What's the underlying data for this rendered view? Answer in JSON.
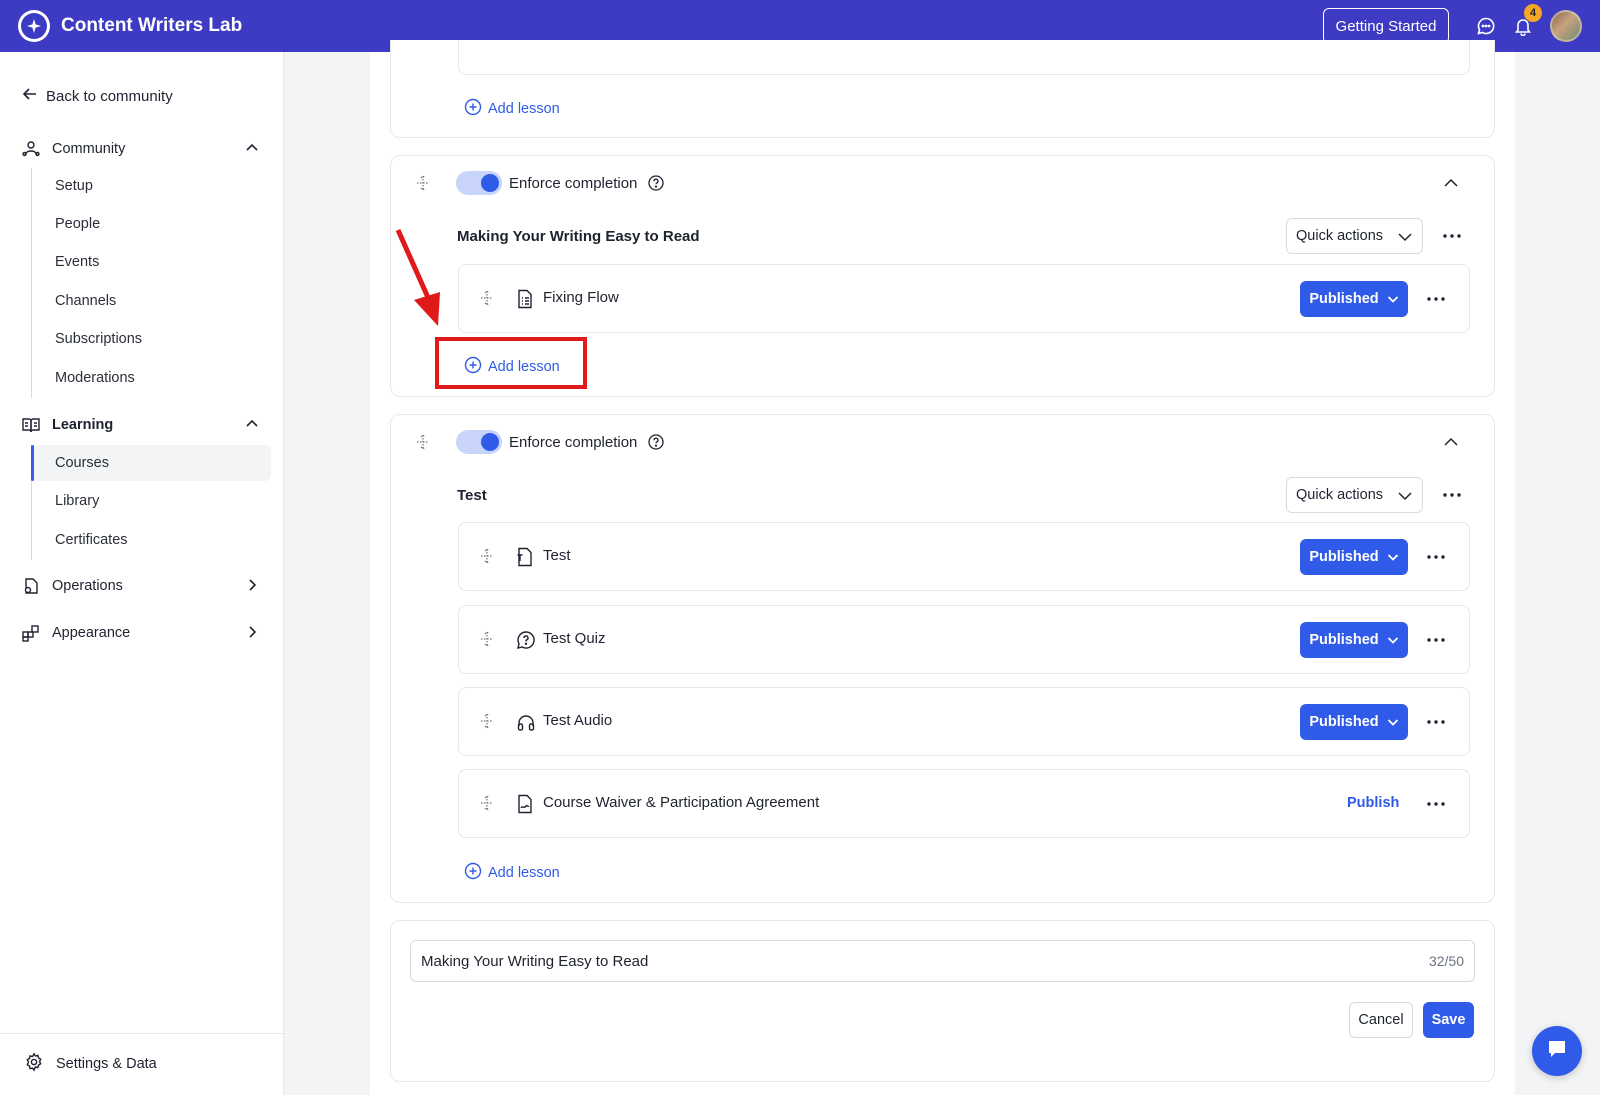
{
  "header": {
    "app_title": "Content Writers Lab",
    "getting_started_label": "Getting Started",
    "notification_count": "4"
  },
  "sidebar": {
    "back_label": "Back to community",
    "community": {
      "label": "Community",
      "items": [
        "Setup",
        "People",
        "Events",
        "Channels",
        "Subscriptions",
        "Moderations"
      ]
    },
    "learning": {
      "label": "Learning",
      "items": [
        "Courses",
        "Library",
        "Certificates"
      ],
      "active": "Courses"
    },
    "operations_label": "Operations",
    "appearance_label": "Appearance",
    "settings_label": "Settings & Data"
  },
  "main": {
    "add_lesson_label": "Add lesson",
    "enforce_label": "Enforce completion",
    "quick_actions_label": "Quick actions",
    "published_label": "Published",
    "publish_label": "Publish",
    "sections": [
      {
        "title": "Making Your Writing Easy to Read",
        "lessons": [
          {
            "title": "Fixing Flow",
            "status": "Published",
            "icon": "document-list-icon"
          }
        ]
      },
      {
        "title": "Test",
        "lessons": [
          {
            "title": "Test",
            "status": "Published",
            "icon": "document-icon"
          },
          {
            "title": "Test Quiz",
            "status": "Published",
            "icon": "quiz-bubble-icon"
          },
          {
            "title": "Test Audio",
            "status": "Published",
            "icon": "headphones-icon"
          },
          {
            "title": "Course Waiver & Participation Agreement",
            "status": "Publish",
            "icon": "document-sign-icon"
          }
        ]
      }
    ],
    "edit": {
      "input_value": "Making Your Writing Easy to Read",
      "char_count": "32/50",
      "cancel_label": "Cancel",
      "save_label": "Save"
    }
  },
  "colors": {
    "brand": "#3d3bc4",
    "accent": "#2f5be8",
    "annotation": "#e01a1a"
  }
}
